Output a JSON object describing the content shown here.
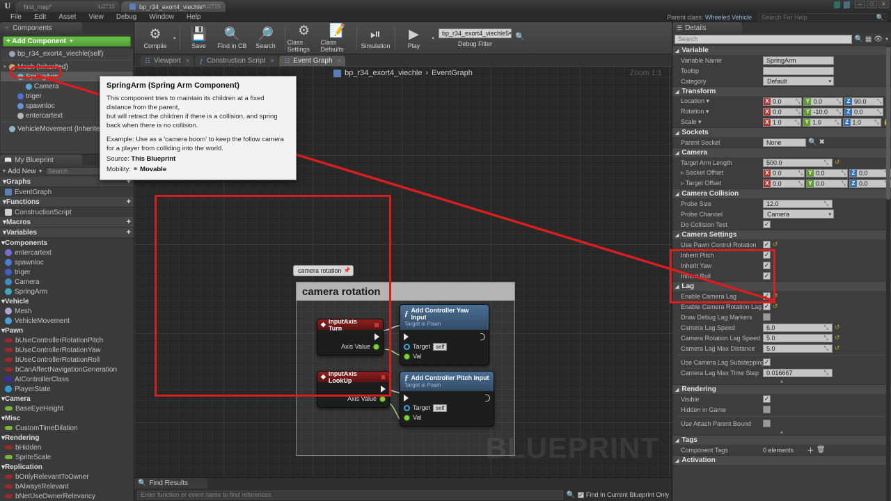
{
  "titlebar": {
    "tabs": [
      {
        "label": "first_map*",
        "active": false
      },
      {
        "label": "bp_r34_exort4_viechle*",
        "active": true
      }
    ],
    "window_buttons": [
      "–",
      "□",
      "X"
    ]
  },
  "menubar": {
    "items": [
      "File",
      "Edit",
      "Asset",
      "View",
      "Debug",
      "Window",
      "Help"
    ],
    "parent_class_label": "Parent class:",
    "parent_class_value": "Wheeled Vehicle",
    "help_search_placeholder": "Search For Help"
  },
  "components_panel": {
    "title": "Components",
    "add_button": "+ Add Component",
    "tree": [
      {
        "label": "bp_r34_exort4_viechle(self)",
        "indent": 0,
        "icon": "actor-icon",
        "selected": false
      },
      {
        "label": "Mesh (Inherited)",
        "indent": 0,
        "icon": "mesh-icon",
        "selected": false,
        "expander": "▾"
      },
      {
        "label": "SpringArm",
        "indent": 1,
        "icon": "springarm-icon",
        "selected": true
      },
      {
        "label": "Camera",
        "indent": 2,
        "icon": "camera-icon",
        "selected": false
      },
      {
        "label": "triger",
        "indent": 1,
        "icon": "collision-icon",
        "selected": false
      },
      {
        "label": "spawnloc",
        "indent": 1,
        "icon": "arrow-icon",
        "selected": false
      },
      {
        "label": "entercartext",
        "indent": 1,
        "icon": "text-icon",
        "selected": false
      },
      {
        "label": "VehicleMovement (Inherited)",
        "indent": 0,
        "icon": "movement-icon",
        "selected": false
      }
    ]
  },
  "tooltip": {
    "title": "SpringArm (Spring Arm Component)",
    "body1": "This component tries to maintain its children at a fixed distance from the parent,",
    "body2": "but will retract the children if there is a collision, and spring back when there is no collision.",
    "body3": "Example: Use as a 'camera boom' to keep the follow camera for a player from colliding into the world.",
    "source_label": "Source:",
    "source_value": "This Blueprint",
    "mobility_label": "Mobility:",
    "mobility_value": "Movable"
  },
  "my_blueprint": {
    "title": "My Blueprint",
    "add_new": "+ Add New",
    "search_placeholder": "Search",
    "sections": [
      {
        "name": "Graphs",
        "plus": true,
        "items": [
          {
            "label": "EventGraph",
            "icon": "graph-icon",
            "color": "#5a7fb5"
          }
        ]
      },
      {
        "name": "Functions",
        "plus": true,
        "items": [
          {
            "label": "ConstructionScript",
            "icon": "function-icon",
            "color": "#cfcfcf"
          }
        ]
      },
      {
        "name": "Macros",
        "plus": true,
        "items": []
      },
      {
        "name": "Variables",
        "plus": true,
        "items": []
      }
    ],
    "categories": [
      {
        "name": "Components",
        "vars": [
          {
            "label": "entercartext",
            "color": "#7a6fd8",
            "shape": "dot"
          },
          {
            "label": "spawnloc",
            "color": "#4a7fd8",
            "shape": "dot"
          },
          {
            "label": "triger",
            "color": "#3f5fc8",
            "shape": "dot"
          },
          {
            "label": "Camera",
            "color": "#3f8fc8",
            "shape": "dot"
          },
          {
            "label": "SpringArm",
            "color": "#3fa8b8",
            "shape": "dot"
          }
        ]
      },
      {
        "name": "Vehicle",
        "vars": [
          {
            "label": "Mesh",
            "color": "#a8a8d8",
            "shape": "dot"
          },
          {
            "label": "VehicleMovement",
            "color": "#4a9fd8",
            "shape": "dot"
          }
        ]
      },
      {
        "name": "Pawn",
        "vars": [
          {
            "label": "bUseControllerRotationPitch",
            "color": "#9c2a2a",
            "shape": "pill"
          },
          {
            "label": "bUseControllerRotationYaw",
            "color": "#9c2a2a",
            "shape": "pill"
          },
          {
            "label": "bUseControllerRotationRoll",
            "color": "#9c2a2a",
            "shape": "pill"
          },
          {
            "label": "bCanAffectNavigationGeneration",
            "color": "#9c2a2a",
            "shape": "pill"
          },
          {
            "label": "AIControllerClass",
            "color": "#3a2a9c",
            "shape": "dot"
          },
          {
            "label": "PlayerState",
            "color": "#2f9fd8",
            "shape": "dot"
          }
        ]
      },
      {
        "name": "Camera",
        "vars": [
          {
            "label": "BaseEyeHeight",
            "color": "#7ab53a",
            "shape": "pill"
          }
        ]
      },
      {
        "name": "Misc",
        "vars": [
          {
            "label": "CustomTimeDilation",
            "color": "#7ab53a",
            "shape": "pill"
          }
        ]
      },
      {
        "name": "Rendering",
        "vars": [
          {
            "label": "bHidden",
            "color": "#9c2a2a",
            "shape": "pill"
          },
          {
            "label": "SpriteScale",
            "color": "#7ab53a",
            "shape": "pill"
          }
        ]
      },
      {
        "name": "Replication",
        "vars": [
          {
            "label": "bOnlyRelevantToOwner",
            "color": "#9c2a2a",
            "shape": "pill"
          },
          {
            "label": "bAlwaysRelevant",
            "color": "#9c2a2a",
            "shape": "pill"
          },
          {
            "label": "bNetUseOwnerRelevancy",
            "color": "#9c2a2a",
            "shape": "pill"
          }
        ]
      }
    ]
  },
  "toolbar": {
    "buttons": [
      {
        "label": "Compile",
        "icon": "compile-icon",
        "glyph": "⚙",
        "has_caret": true
      },
      {
        "label": "Save",
        "icon": "save-icon",
        "glyph": "💾",
        "has_caret": false
      },
      {
        "label": "Find in CB",
        "icon": "find-in-cb-icon",
        "glyph": "🔍",
        "has_caret": false
      },
      {
        "label": "Search",
        "icon": "search-icon",
        "glyph": "🔎",
        "has_caret": false
      },
      {
        "label": "Class Settings",
        "icon": "class-settings-icon",
        "glyph": "⚙",
        "has_caret": false
      },
      {
        "label": "Class Defaults",
        "icon": "class-defaults-icon",
        "glyph": "📝",
        "has_caret": false
      },
      {
        "label": "Simulation",
        "icon": "simulation-icon",
        "glyph": "⏯",
        "has_caret": false
      },
      {
        "label": "Play",
        "icon": "play-icon",
        "glyph": "▶",
        "has_caret": true
      }
    ],
    "debug_filter_value": "bp_r34_exort4_viechle5",
    "debug_filter_label": "Debug Filter"
  },
  "subtabs": [
    {
      "label": "Viewport",
      "icon": "viewport-icon",
      "active": false
    },
    {
      "label": "Construction Script",
      "icon": "function-icon",
      "active": false
    },
    {
      "label": "Event Graph",
      "icon": "graph-icon",
      "active": true
    }
  ],
  "graph": {
    "breadcrumb_root": "bp_r34_exort4_viechle",
    "breadcrumb_sep": "›",
    "breadcrumb_leaf": "EventGraph",
    "zoom_label": "Zoom 1:1",
    "watermark": "BLUEPRINT",
    "comment_bubble": "camera rotation",
    "comment_title": "camera rotation",
    "nodes": [
      {
        "id": "input-axis-turn",
        "type": "event",
        "title": "InputAxis Turn",
        "outputs": [
          {
            "label": "",
            "pin": "exec"
          },
          {
            "label": "Axis Value",
            "pin": "float"
          }
        ]
      },
      {
        "id": "add-controller-yaw-input",
        "type": "function",
        "title": "Add Controller Yaw Input",
        "subtitle": "Target is Pawn",
        "inputs": [
          {
            "label": "",
            "pin": "exec"
          },
          {
            "label": "Target",
            "pin": "object",
            "value": "self"
          },
          {
            "label": "Val",
            "pin": "float"
          }
        ]
      },
      {
        "id": "input-axis-lookup",
        "type": "event",
        "title": "InputAxis LookUp",
        "outputs": [
          {
            "label": "",
            "pin": "exec"
          },
          {
            "label": "Axis Value",
            "pin": "float"
          }
        ]
      },
      {
        "id": "add-controller-pitch-input",
        "type": "function",
        "title": "Add Controller Pitch Input",
        "subtitle": "Target is Pawn",
        "inputs": [
          {
            "label": "",
            "pin": "exec"
          },
          {
            "label": "Target",
            "pin": "object",
            "value": "self"
          },
          {
            "label": "Val",
            "pin": "float"
          }
        ]
      }
    ]
  },
  "find_results": {
    "tab_label": "Find Results",
    "input_placeholder": "Enter function or event name to find references",
    "checkbox_label": "Find In Current Blueprint Only",
    "checkbox_checked": true
  },
  "details": {
    "title": "Details",
    "search_placeholder": "Search",
    "sections": [
      {
        "name": "Variable",
        "rows": [
          {
            "label": "Variable Name",
            "type": "text",
            "value": "SpringArm"
          },
          {
            "label": "Tooltip",
            "type": "text",
            "value": ""
          },
          {
            "label": "Category",
            "type": "dropdown",
            "value": "Default"
          }
        ]
      },
      {
        "name": "Transform",
        "rows": [
          {
            "label": "Location",
            "type": "vector",
            "dropdown": true,
            "x": "0.0",
            "y": "0.0",
            "z": "90.0",
            "reset": true
          },
          {
            "label": "Rotation",
            "type": "vector",
            "dropdown": true,
            "x": "0.0",
            "y": "-10.0",
            "z": "0.0",
            "reset": true
          },
          {
            "label": "Scale",
            "type": "vector",
            "dropdown": true,
            "x": "1.0",
            "y": "1.0",
            "z": "1.0",
            "lock": true
          }
        ]
      },
      {
        "name": "Sockets",
        "rows": [
          {
            "label": "Parent Socket",
            "type": "socket",
            "value": "None"
          }
        ]
      },
      {
        "name": "Camera",
        "rows": [
          {
            "label": "Target Arm Length",
            "type": "number",
            "value": "500.0",
            "reset": true
          },
          {
            "label": "Socket Offset",
            "type": "vector",
            "expander": true,
            "x": "0.0",
            "y": "0.0",
            "z": "0.0"
          },
          {
            "label": "Target Offset",
            "type": "vector",
            "expander": true,
            "x": "0.0",
            "y": "0.0",
            "z": "0.0"
          }
        ]
      },
      {
        "name": "Camera Collision",
        "rows": [
          {
            "label": "Probe Size",
            "type": "number",
            "value": "12.0"
          },
          {
            "label": "Probe Channel",
            "type": "dropdown",
            "value": "Camera"
          },
          {
            "label": "Do Collision Test",
            "type": "checkbox",
            "checked": true
          }
        ]
      },
      {
        "name": "Camera Settings",
        "highlighted": true,
        "rows": [
          {
            "label": "Use Pawn Control Rotation",
            "type": "checkbox",
            "checked": true,
            "reset": true
          },
          {
            "label": "Inherit Pitch",
            "type": "checkbox",
            "checked": true
          },
          {
            "label": "Inherit Yaw",
            "type": "checkbox",
            "checked": true
          },
          {
            "label": "Inherit Roll",
            "type": "checkbox",
            "checked": true
          }
        ]
      },
      {
        "name": "Lag",
        "rows": [
          {
            "label": "Enable Camera Lag",
            "type": "checkbox",
            "checked": true,
            "reset": true
          },
          {
            "label": "Enable Camera Rotation Lag",
            "type": "checkbox",
            "checked": true,
            "reset": true
          },
          {
            "label": "Draw Debug Lag Markers",
            "type": "checkbox",
            "checked": false
          },
          {
            "label": "Camera Lag Speed",
            "type": "number",
            "value": "6.0",
            "reset": true
          },
          {
            "label": "Camera Rotation Lag Speed",
            "type": "number",
            "value": "5.0",
            "reset": true
          },
          {
            "label": "Camera Lag Max Distance",
            "type": "number",
            "value": "5.0",
            "reset": true
          },
          {
            "divider": true
          },
          {
            "label": "Use Camera Lag Substepping",
            "type": "checkbox",
            "checked": true
          },
          {
            "label": "Camera Lag Max Time Step",
            "type": "number",
            "value": "0.016667"
          }
        ],
        "collapse_arrow": true
      },
      {
        "name": "Rendering",
        "rows": [
          {
            "label": "Visible",
            "type": "checkbox",
            "checked": true
          },
          {
            "label": "Hidden in Game",
            "type": "checkbox",
            "checked": false
          },
          {
            "divider": true
          },
          {
            "label": "Use Attach Parent Bound",
            "type": "checkbox",
            "checked": false
          }
        ],
        "collapse_arrow": true
      },
      {
        "name": "Tags",
        "rows": [
          {
            "label": "Component Tags",
            "type": "elements",
            "value": "0 elements"
          }
        ]
      },
      {
        "name": "Activation",
        "rows": []
      }
    ]
  }
}
